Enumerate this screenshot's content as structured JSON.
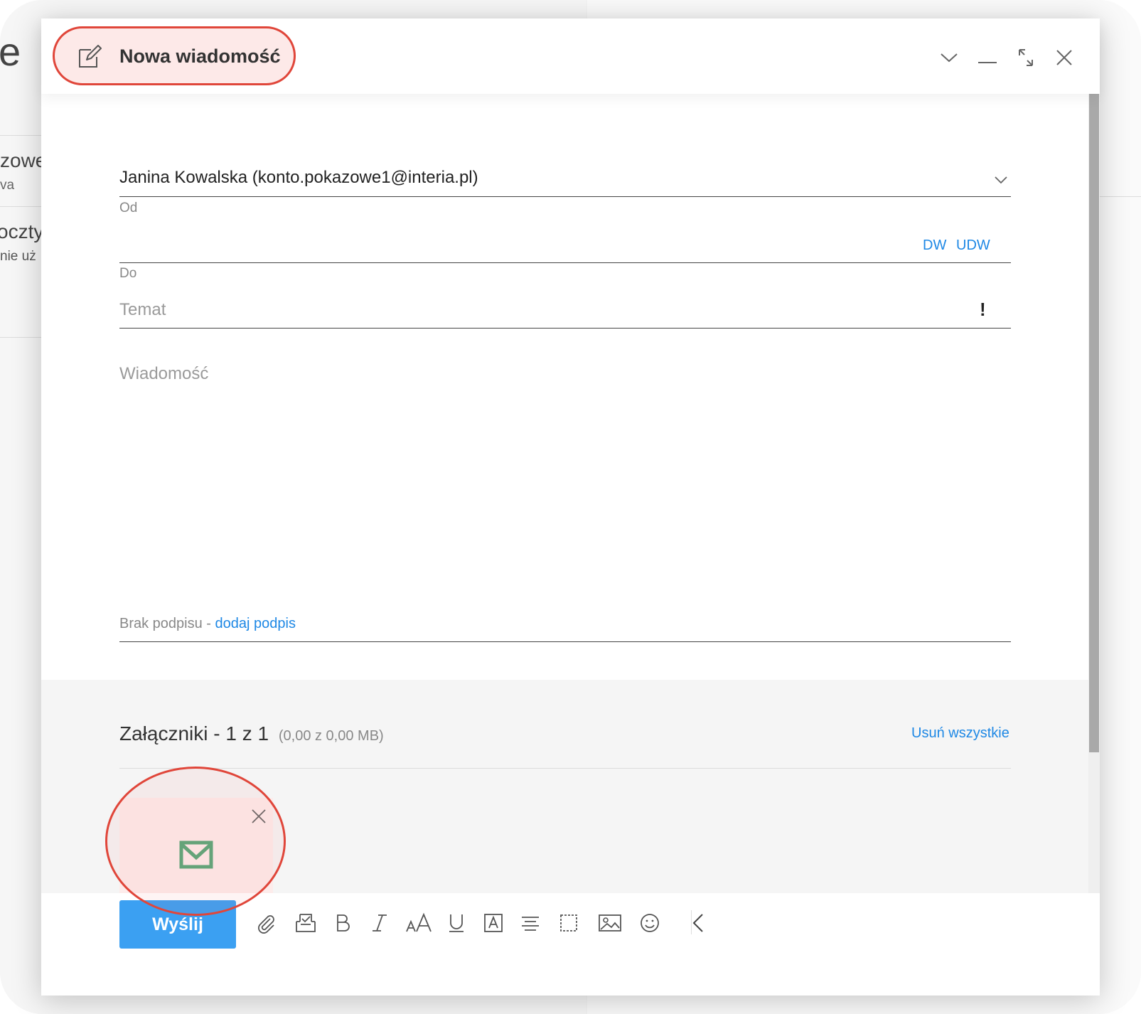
{
  "background": {
    "fragments": [
      "e",
      "zowe",
      "va",
      "oczty",
      "nie uż"
    ]
  },
  "dialog": {
    "title": "Nowa wiadomość",
    "header_icons": [
      "compose-icon",
      "chevron-down-icon",
      "minimize-icon",
      "expand-icon",
      "close-icon"
    ]
  },
  "form": {
    "from_value": "Janina Kowalska (konto.pokazowe1@interia.pl)",
    "from_label": "Od",
    "to_label": "Do",
    "to_value": "",
    "cc_label": "DW",
    "bcc_label": "UDW",
    "subject_placeholder": "Temat",
    "priority_label": "!",
    "message_placeholder": "Wiadomość",
    "signature_text": "Brak podpisu - ",
    "signature_link": "dodaj podpis"
  },
  "attachments": {
    "title": "Załączniki - 1 z 1",
    "size": "(0,00 z 0,00 MB)",
    "remove_all": "Usuń wszystkie",
    "items": [
      {
        "type": "mail-icon"
      }
    ]
  },
  "footer": {
    "send_label": "Wyślij",
    "toolbar": [
      "attach-icon",
      "template-icon",
      "bold-icon",
      "italic-icon",
      "font-size-icon",
      "underline-icon",
      "text-color-icon",
      "align-icon",
      "border-icon",
      "image-icon",
      "emoji-icon",
      "collapse-icon"
    ]
  },
  "colors": {
    "accent": "#3ba0f2",
    "link": "#1e88e5",
    "highlight": "#e0463a",
    "mail_icon": "#5aa87a"
  }
}
